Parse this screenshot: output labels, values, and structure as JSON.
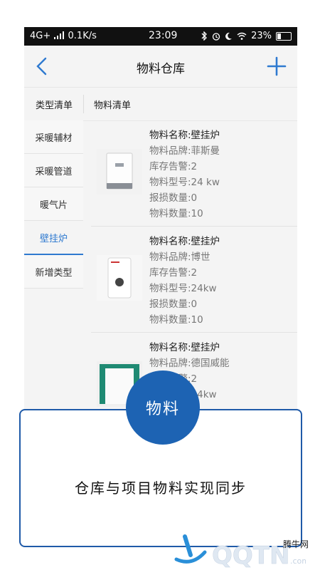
{
  "status_bar": {
    "network": "4G+",
    "speed": "0.1K/s",
    "time": "23:09",
    "battery": "23%",
    "icons": [
      "signal-icon",
      "bluetooth-icon",
      "alarm-icon",
      "moon-icon",
      "wifi-icon",
      "battery-icon"
    ]
  },
  "header": {
    "title": "物料仓库",
    "back_icon": "back-chevron-icon",
    "add_icon": "plus-icon"
  },
  "tabs": [
    {
      "label": "类型清单"
    },
    {
      "label": "物料清单"
    }
  ],
  "sidebar": {
    "items": [
      {
        "label": "采暖辅材"
      },
      {
        "label": "采暖管道"
      },
      {
        "label": "暖气片"
      },
      {
        "label": "壁挂炉",
        "active": true
      },
      {
        "label": "新增类型"
      }
    ]
  },
  "materials": [
    {
      "name": "物料名称:壁挂炉",
      "brand": "物料品牌:菲斯曼",
      "stock_alert": "库存告警:2",
      "model": "物料型号:24 kw",
      "damaged": "报损数量:0",
      "quantity": "物料数量:10"
    },
    {
      "name": "物料名称:壁挂炉",
      "brand": "物料品牌:博世",
      "stock_alert": "库存告警:2",
      "model": "物料型号:24kw",
      "damaged": "报损数量:0",
      "quantity": "物料数量:10"
    },
    {
      "name": "物料名称:壁挂炉",
      "brand": "物料品牌:德国威能",
      "stock_alert": "库存告警:2",
      "model": "物料型号:24kw"
    }
  ],
  "promo": {
    "badge": "物料",
    "caption": "仓库与项目物料实现同步"
  },
  "watermark": {
    "site": "腾牛网",
    "logo": "QQTN.com"
  },
  "colors": {
    "accent": "#2f7ad0",
    "badge": "#1d63b3",
    "card_border": "#1f5aa8"
  }
}
